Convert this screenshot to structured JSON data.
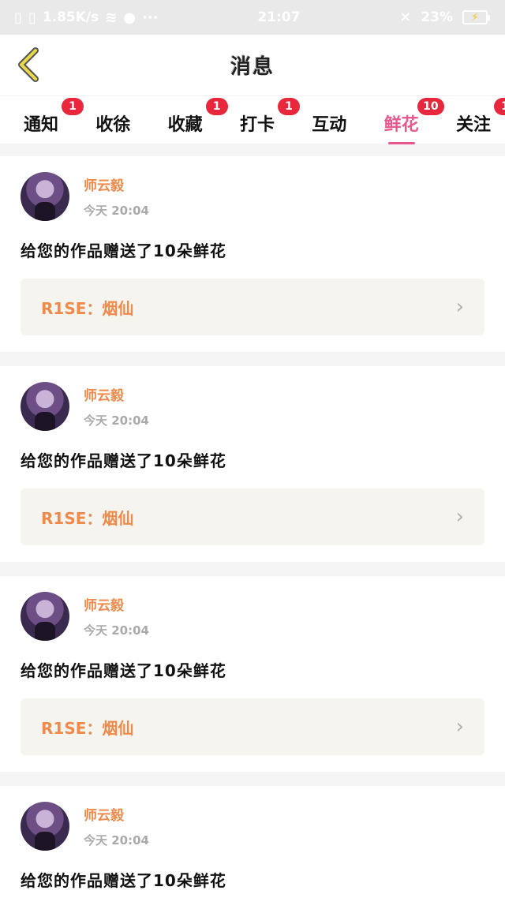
{
  "status_bar": {
    "speed": "1.85K/s",
    "time": "21:07",
    "battery": "23%"
  },
  "header": {
    "title": "消息"
  },
  "tabs": [
    {
      "label": "通知",
      "badge": "1",
      "active": false
    },
    {
      "label": "收徐",
      "badge": "",
      "active": false
    },
    {
      "label": "收藏",
      "badge": "1",
      "active": false
    },
    {
      "label": "打卡",
      "badge": "1",
      "active": false
    },
    {
      "label": "互动",
      "badge": "",
      "active": false
    },
    {
      "label": "鲜花",
      "badge": "10",
      "active": true
    },
    {
      "label": "关注",
      "badge": "1",
      "active": false
    }
  ],
  "messages": [
    {
      "username": "师云毅",
      "time": "今天 20:04",
      "text": "给您的作品赠送了10朵鲜花",
      "work": "R1SE：烟仙"
    },
    {
      "username": "师云毅",
      "time": "今天 20:04",
      "text": "给您的作品赠送了10朵鲜花",
      "work": "R1SE：烟仙"
    },
    {
      "username": "师云毅",
      "time": "今天 20:04",
      "text": "给您的作品赠送了10朵鲜花",
      "work": "R1SE：烟仙"
    },
    {
      "username": "师云毅",
      "time": "今天 20:04",
      "text": "给您的作品赠送了10朵鲜花",
      "work": ""
    }
  ],
  "icons": {
    "back": "chevron-left-icon",
    "work_arrow": "chevron-right-icon"
  },
  "colors": {
    "accent": "#e8588e",
    "badge": "#e8263c",
    "username": "#f08a4b",
    "back_icon": "#e9d94a"
  }
}
